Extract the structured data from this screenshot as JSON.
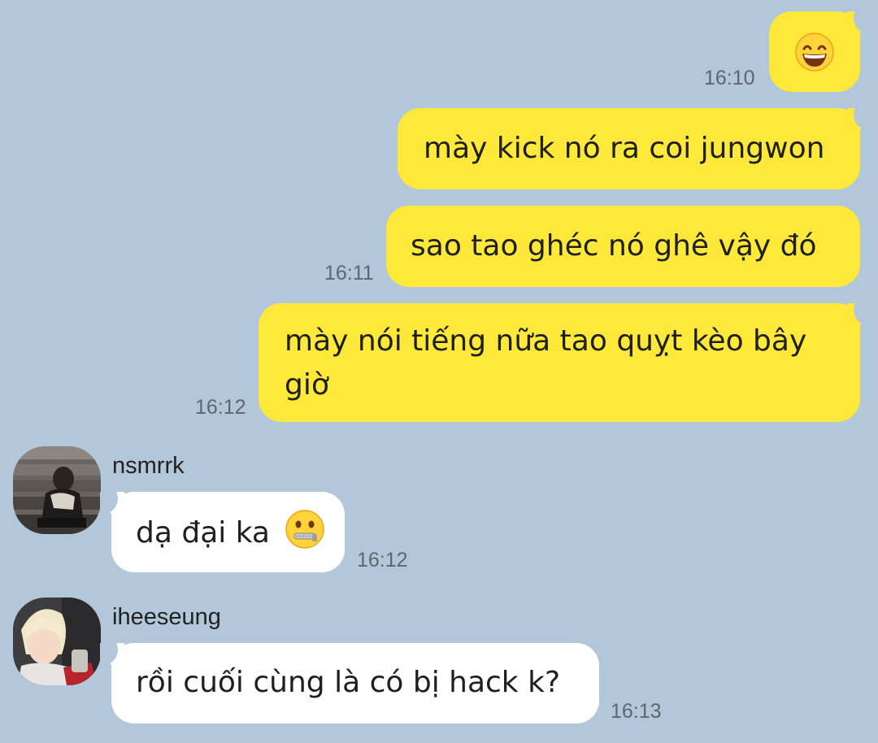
{
  "chat": {
    "messages": [
      {
        "sender": "me",
        "emoji": "grinning-face-with-smiling-eyes",
        "time": "16:10"
      },
      {
        "sender": "me",
        "text": "mày kick nó ra coi jungwon"
      },
      {
        "sender": "me",
        "text": "sao tao ghéc nó ghê vậy đó",
        "time": "16:11"
      },
      {
        "sender": "me",
        "text": "mày nói tiếng nữa tao quỵt kèo bây giờ",
        "time": "16:12"
      },
      {
        "sender": "nsmrrk",
        "name": "nsmrrk",
        "text": "dạ đại ka",
        "emoji": "zipper-mouth-face",
        "time": "16:12"
      },
      {
        "sender": "iheeseung",
        "name": "iheeseung",
        "text": "rồi cuối cùng là có bị hack k?",
        "time": "16:13"
      }
    ]
  },
  "colors": {
    "background": "#b2c7da",
    "outgoing_bubble": "#fee83a",
    "incoming_bubble": "#ffffff",
    "timestamp": "#5f6670"
  }
}
